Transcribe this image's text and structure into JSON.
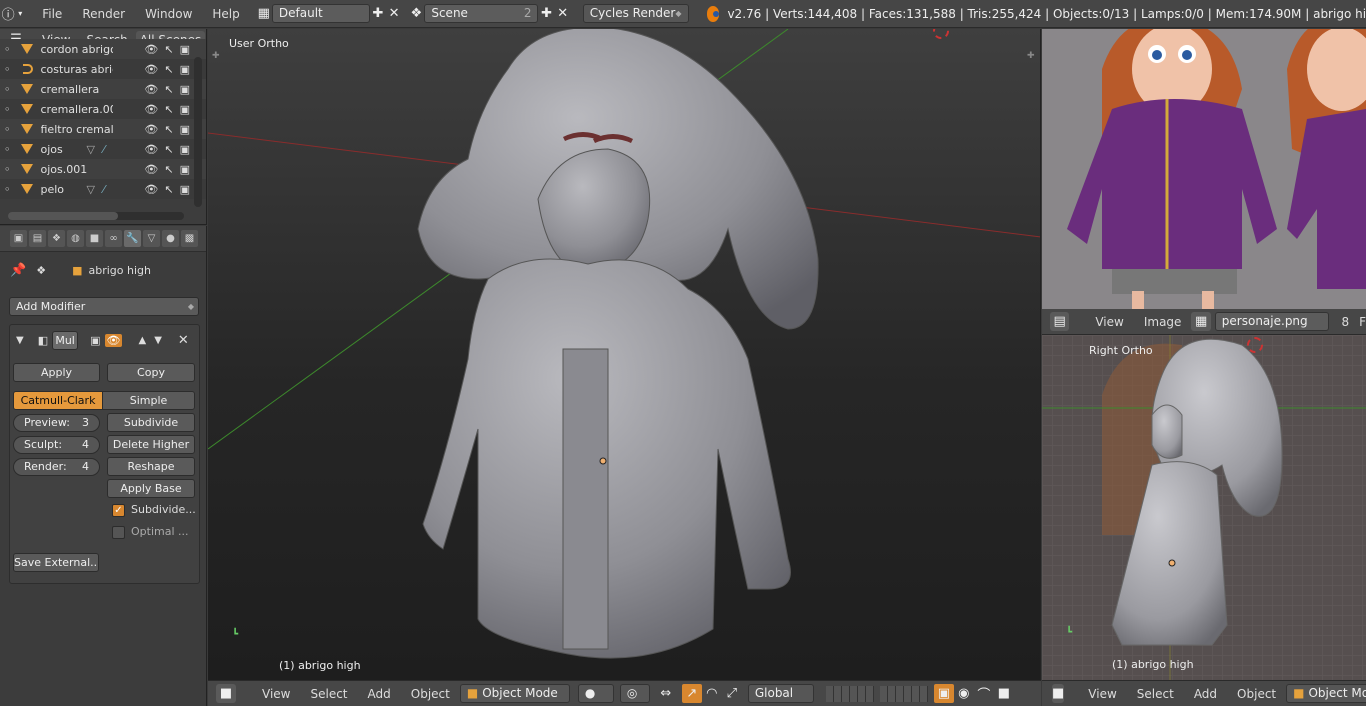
{
  "topbar": {
    "menus": [
      "File",
      "Render",
      "Window",
      "Help"
    ],
    "layout": "Default",
    "scene": "Scene",
    "scene_count": "2",
    "engine": "Cycles Render",
    "stats": "v2.76 | Verts:144,408 | Faces:131,588 | Tris:255,424 | Objects:0/13 | Lamps:0/0 | Mem:174.90M | abrigo hi"
  },
  "outliner": {
    "header": [
      "View",
      "Search",
      "All Scenes"
    ],
    "items": [
      {
        "name": "cordon abrigo",
        "type": "mesh"
      },
      {
        "name": "costuras abrig",
        "type": "curve"
      },
      {
        "name": "cremallera",
        "type": "mesh"
      },
      {
        "name": "cremallera.00",
        "type": "mesh"
      },
      {
        "name": "fieltro cremall",
        "type": "mesh"
      },
      {
        "name": "ojos",
        "type": "mesh"
      },
      {
        "name": "ojos.001",
        "type": "mesh"
      },
      {
        "name": "pelo",
        "type": "mesh"
      }
    ]
  },
  "properties": {
    "object_name": "abrigo high",
    "add_modifier": "Add Modifier",
    "modifier_name": "Mul",
    "apply": "Apply",
    "copy": "Copy",
    "catmull": "Catmull-Clark",
    "simple": "Simple",
    "preview_label": "Preview:",
    "preview_value": "3",
    "sculpt_label": "Sculpt:",
    "sculpt_value": "4",
    "render_label": "Render:",
    "render_value": "4",
    "subdivide": "Subdivide",
    "delete_higher": "Delete Higher",
    "reshape": "Reshape",
    "apply_base": "Apply Base",
    "subdivide_uvs": "Subdivide...",
    "optimal": "Optimal ...",
    "save_external": "Save External..."
  },
  "viewport": {
    "view_name": "User Ortho",
    "active": "(1) abrigo high",
    "menus": [
      "View",
      "Select",
      "Add",
      "Object"
    ],
    "mode": "Object Mode",
    "orientation": "Global"
  },
  "image_editor": {
    "menus": [
      "View",
      "Image"
    ],
    "image_name": "personaje.png",
    "users": "8",
    "extra": "F"
  },
  "right_viewport": {
    "view_name": "Right Ortho",
    "active": "(1) abrigo high",
    "menus": [
      "View",
      "Select",
      "Add",
      "Object"
    ],
    "mode": "Object Mode"
  },
  "colors": {
    "accent": "#e5993c",
    "mesh_icon": "#e6a23c",
    "purple_coat": "#6a2d7d"
  }
}
